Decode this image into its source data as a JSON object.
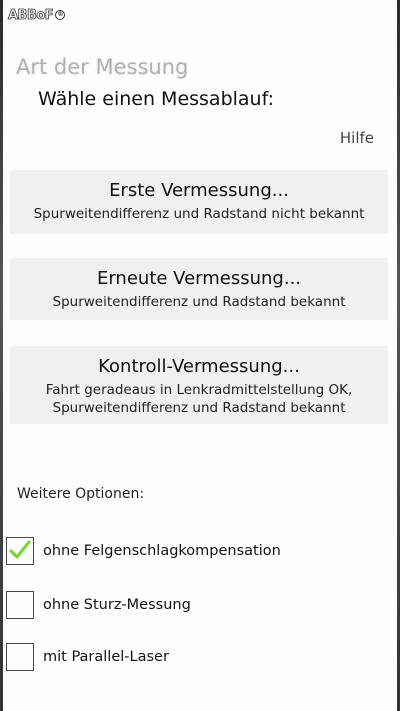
{
  "app": {
    "logo_text": "ABBoF"
  },
  "screen": {
    "title": "Art der Messung",
    "subtitle": "Wähle einen Messablauf:",
    "help_label": "Hilfe"
  },
  "options": [
    {
      "title": "Erste Vermessung...",
      "description": "Spurweitendifferenz und Radstand nicht bekannt"
    },
    {
      "title": "Erneute Vermessung...",
      "description": "Spurweitendifferenz und Radstand bekannt"
    },
    {
      "title": "Kontroll-Vermessung...",
      "description_line1": "Fahrt geradeaus in Lenkradmittelstellung OK,",
      "description_line2": "Spurweitendifferenz und Radstand bekannt"
    }
  ],
  "further_options": {
    "label": "Weitere Optionen:",
    "items": [
      {
        "label": "ohne Felgenschlagkompensation",
        "checked": true
      },
      {
        "label": "ohne Sturz-Messung",
        "checked": false
      },
      {
        "label": "mit Parallel-Laser",
        "checked": false
      }
    ]
  },
  "colors": {
    "check_mark": "#7cd33a",
    "card_background": "#f0f0f0",
    "title_gray": "#b0b0b0"
  }
}
